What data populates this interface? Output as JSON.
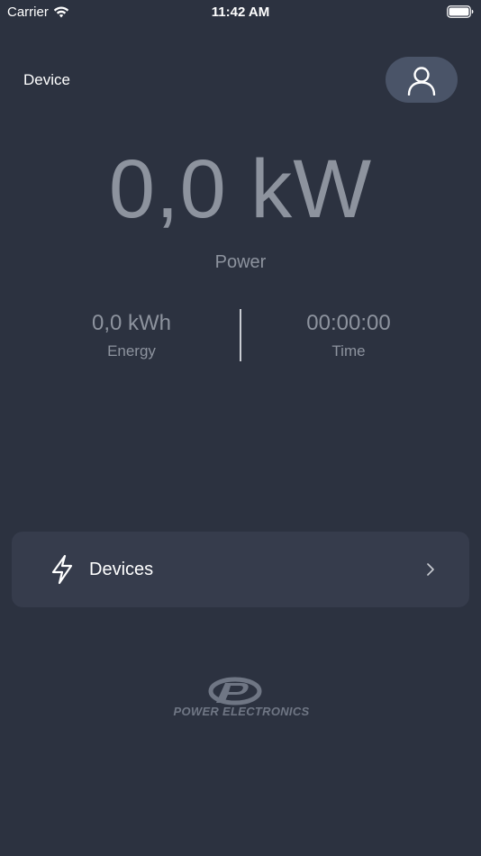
{
  "status_bar": {
    "carrier": "Carrier",
    "time": "11:42 AM"
  },
  "header": {
    "title": "Device",
    "profile_icon": "user-icon"
  },
  "power": {
    "value": "0,0 kW",
    "label": "Power"
  },
  "energy": {
    "value": "0,0 kWh",
    "label": "Energy"
  },
  "time_metric": {
    "value": "00:00:00",
    "label": "Time"
  },
  "devices_row": {
    "label": "Devices",
    "icon": "lightning-bolt-icon"
  },
  "brand": {
    "name": "POWER ELECTRONICS"
  },
  "colors": {
    "background": "#2c3240",
    "card": "#363c4c",
    "profile_button": "#4a5468",
    "muted_text": "#8d939e"
  }
}
